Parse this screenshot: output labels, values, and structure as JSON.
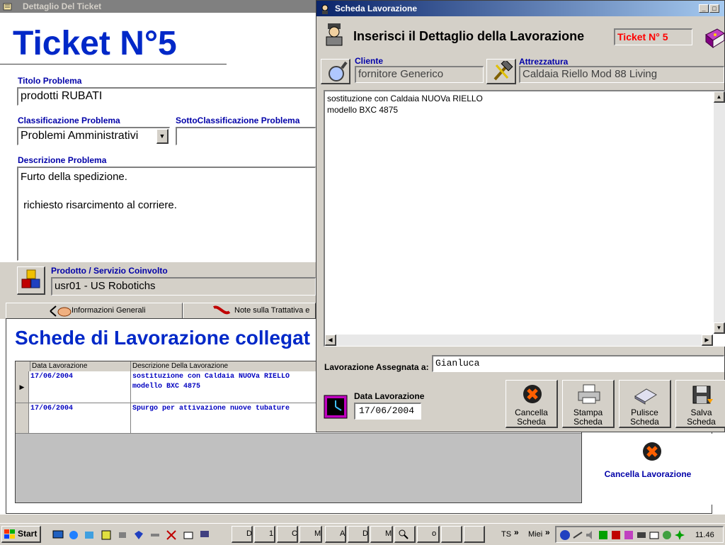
{
  "back": {
    "window_title": "Dettaglio Del Ticket",
    "heading": "Ticket N°5",
    "titolo_label": "Titolo Problema",
    "titolo_value": "prodotti RUBATI",
    "classificazione_label": "Classificazione Problema",
    "classificazione_value": "Problemi Amministrativi",
    "sottoclass_label": "SottoClassificazione Problema",
    "sottoclass_value": "",
    "descrizione_label": "Descrizione Problema",
    "descrizione_line1": "Furto della spedizione.",
    "descrizione_line2": " richiesto risarcimento al corriere.",
    "prodotto_label": "Prodotto / Servizio Coinvolto",
    "prodotto_value": "usr01 - US Robotichs",
    "tabs": [
      {
        "label": "Informazioni Generali"
      },
      {
        "label": "Note sulla Trattativa e A"
      }
    ],
    "schede_heading": "Schede di Lavorazione collegat",
    "grid": {
      "col_data": "Data Lavorazione",
      "col_desc": "Descrizione Della Lavorazione",
      "rows": [
        {
          "data": "17/06/2004",
          "desc1": "sostituzione con Caldaia NUOVa RIELLO",
          "desc2": "modello BXC 4875"
        },
        {
          "data": "17/06/2004",
          "desc1": "Spurgo per attivazione nuove tubature",
          "desc2": ""
        }
      ]
    },
    "cancella_lavorazione": "Cancella Lavorazione"
  },
  "front": {
    "window_title": "Scheda Lavorazione",
    "header_title": "Inserisci il Dettaglio della Lavorazione",
    "ticket_badge": "Ticket N° 5",
    "cliente_label": "Cliente",
    "cliente_value": "fornitore Generico",
    "attrezzatura_label": "Attrezzatura",
    "attrezzatura_value": "Caldaia Riello Mod 88 Living",
    "text_line1": "sostituzione con Caldaia NUOVa RIELLO",
    "text_line2": "modello BXC 4875",
    "assegnata_label": "Lavorazione Assegnata a:",
    "assegnata_value": "Gianluca",
    "data_label": "Data Lavorazione",
    "data_value": "17/06/2004",
    "buttons": [
      {
        "line1": "Cancella",
        "line2": "Scheda"
      },
      {
        "line1": "Stampa",
        "line2": "Scheda"
      },
      {
        "line1": "Pulisce",
        "line2": "Scheda"
      },
      {
        "line1": "Salva",
        "line2": "Scheda"
      }
    ]
  },
  "taskbar": {
    "start": "Start",
    "items": [
      {
        "label": "D"
      },
      {
        "label": "1"
      },
      {
        "label": "C"
      },
      {
        "label": "M"
      },
      {
        "label": "A"
      },
      {
        "label": "D"
      },
      {
        "label": "M"
      },
      {
        "label": "o"
      }
    ],
    "ts": "TS",
    "miei": "Miei",
    "clock": "11.46"
  },
  "colors": {
    "label_blue": "#0000a8",
    "heading_blue": "#0028c8",
    "badge_red": "#ff0000",
    "titlebar_start": "#0a246a"
  }
}
